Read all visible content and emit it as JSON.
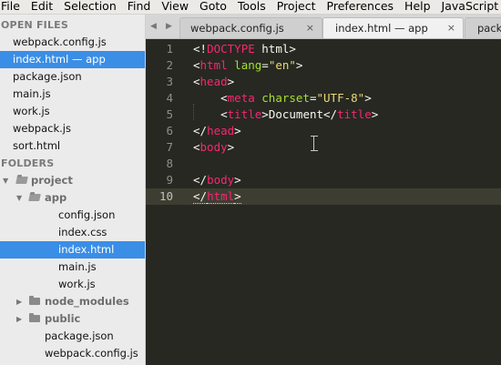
{
  "menubar": [
    "File",
    "Edit",
    "Selection",
    "Find",
    "View",
    "Goto",
    "Tools",
    "Project",
    "Preferences",
    "Help",
    "JavaScript Co"
  ],
  "sidebar": {
    "open_files_header": "OPEN FILES",
    "open_files": [
      "webpack.config.js",
      "index.html — app",
      "package.json",
      "main.js",
      "work.js",
      "webpack.js",
      "sort.html"
    ],
    "folders_header": "FOLDERS",
    "tree": {
      "project": "project",
      "app": "app",
      "app_files": [
        "config.json",
        "index.css",
        "index.html",
        "main.js",
        "work.js"
      ],
      "node_modules": "node_modules",
      "public": "public",
      "root_files": [
        "package.json",
        "webpack.config.js"
      ]
    }
  },
  "tabs": {
    "nav_left": "◀",
    "nav_right": "▶",
    "items": [
      {
        "label": "webpack.config.js",
        "close": "×"
      },
      {
        "label": "index.html — app",
        "close": "×"
      },
      {
        "label": "packa"
      }
    ]
  },
  "editor": {
    "line_numbers": [
      "1",
      "2",
      "3",
      "4",
      "5",
      "6",
      "7",
      "8",
      "9",
      "10"
    ],
    "lines": [
      [
        "<!",
        "DOCTYPE",
        " html>"
      ],
      [
        "<",
        "html",
        " ",
        "lang",
        "=",
        "\"en\"",
        ">"
      ],
      [
        "<",
        "head",
        ">"
      ],
      [
        "    <",
        "meta",
        " ",
        "charset",
        "=",
        "\"UTF-8\"",
        ">"
      ],
      [
        "    <",
        "title",
        ">",
        "Document",
        "</",
        "title",
        ">"
      ],
      [
        "</",
        "head",
        ">"
      ],
      [
        "<",
        "body",
        ">"
      ],
      [],
      [
        "</",
        "body",
        ">"
      ],
      [
        "</",
        "html",
        ">"
      ]
    ]
  }
}
